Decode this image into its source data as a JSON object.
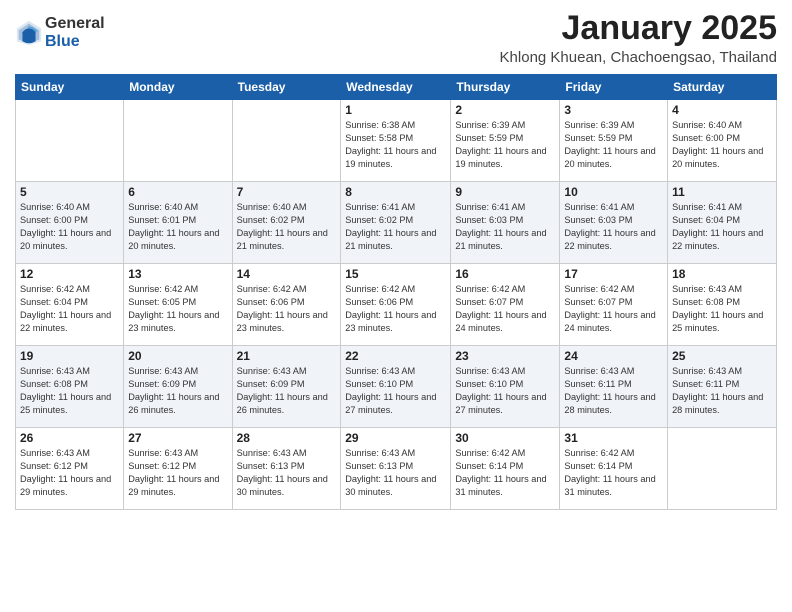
{
  "header": {
    "logo_general": "General",
    "logo_blue": "Blue",
    "month": "January 2025",
    "location": "Khlong Khuean, Chachoengsao, Thailand"
  },
  "days_of_week": [
    "Sunday",
    "Monday",
    "Tuesday",
    "Wednesday",
    "Thursday",
    "Friday",
    "Saturday"
  ],
  "weeks": [
    [
      {
        "day": "",
        "sunrise": "",
        "sunset": "",
        "daylight": ""
      },
      {
        "day": "",
        "sunrise": "",
        "sunset": "",
        "daylight": ""
      },
      {
        "day": "",
        "sunrise": "",
        "sunset": "",
        "daylight": ""
      },
      {
        "day": "1",
        "sunrise": "Sunrise: 6:38 AM",
        "sunset": "Sunset: 5:58 PM",
        "daylight": "Daylight: 11 hours and 19 minutes."
      },
      {
        "day": "2",
        "sunrise": "Sunrise: 6:39 AM",
        "sunset": "Sunset: 5:59 PM",
        "daylight": "Daylight: 11 hours and 19 minutes."
      },
      {
        "day": "3",
        "sunrise": "Sunrise: 6:39 AM",
        "sunset": "Sunset: 5:59 PM",
        "daylight": "Daylight: 11 hours and 20 minutes."
      },
      {
        "day": "4",
        "sunrise": "Sunrise: 6:40 AM",
        "sunset": "Sunset: 6:00 PM",
        "daylight": "Daylight: 11 hours and 20 minutes."
      }
    ],
    [
      {
        "day": "5",
        "sunrise": "Sunrise: 6:40 AM",
        "sunset": "Sunset: 6:00 PM",
        "daylight": "Daylight: 11 hours and 20 minutes."
      },
      {
        "day": "6",
        "sunrise": "Sunrise: 6:40 AM",
        "sunset": "Sunset: 6:01 PM",
        "daylight": "Daylight: 11 hours and 20 minutes."
      },
      {
        "day": "7",
        "sunrise": "Sunrise: 6:40 AM",
        "sunset": "Sunset: 6:02 PM",
        "daylight": "Daylight: 11 hours and 21 minutes."
      },
      {
        "day": "8",
        "sunrise": "Sunrise: 6:41 AM",
        "sunset": "Sunset: 6:02 PM",
        "daylight": "Daylight: 11 hours and 21 minutes."
      },
      {
        "day": "9",
        "sunrise": "Sunrise: 6:41 AM",
        "sunset": "Sunset: 6:03 PM",
        "daylight": "Daylight: 11 hours and 21 minutes."
      },
      {
        "day": "10",
        "sunrise": "Sunrise: 6:41 AM",
        "sunset": "Sunset: 6:03 PM",
        "daylight": "Daylight: 11 hours and 22 minutes."
      },
      {
        "day": "11",
        "sunrise": "Sunrise: 6:41 AM",
        "sunset": "Sunset: 6:04 PM",
        "daylight": "Daylight: 11 hours and 22 minutes."
      }
    ],
    [
      {
        "day": "12",
        "sunrise": "Sunrise: 6:42 AM",
        "sunset": "Sunset: 6:04 PM",
        "daylight": "Daylight: 11 hours and 22 minutes."
      },
      {
        "day": "13",
        "sunrise": "Sunrise: 6:42 AM",
        "sunset": "Sunset: 6:05 PM",
        "daylight": "Daylight: 11 hours and 23 minutes."
      },
      {
        "day": "14",
        "sunrise": "Sunrise: 6:42 AM",
        "sunset": "Sunset: 6:06 PM",
        "daylight": "Daylight: 11 hours and 23 minutes."
      },
      {
        "day": "15",
        "sunrise": "Sunrise: 6:42 AM",
        "sunset": "Sunset: 6:06 PM",
        "daylight": "Daylight: 11 hours and 23 minutes."
      },
      {
        "day": "16",
        "sunrise": "Sunrise: 6:42 AM",
        "sunset": "Sunset: 6:07 PM",
        "daylight": "Daylight: 11 hours and 24 minutes."
      },
      {
        "day": "17",
        "sunrise": "Sunrise: 6:42 AM",
        "sunset": "Sunset: 6:07 PM",
        "daylight": "Daylight: 11 hours and 24 minutes."
      },
      {
        "day": "18",
        "sunrise": "Sunrise: 6:43 AM",
        "sunset": "Sunset: 6:08 PM",
        "daylight": "Daylight: 11 hours and 25 minutes."
      }
    ],
    [
      {
        "day": "19",
        "sunrise": "Sunrise: 6:43 AM",
        "sunset": "Sunset: 6:08 PM",
        "daylight": "Daylight: 11 hours and 25 minutes."
      },
      {
        "day": "20",
        "sunrise": "Sunrise: 6:43 AM",
        "sunset": "Sunset: 6:09 PM",
        "daylight": "Daylight: 11 hours and 26 minutes."
      },
      {
        "day": "21",
        "sunrise": "Sunrise: 6:43 AM",
        "sunset": "Sunset: 6:09 PM",
        "daylight": "Daylight: 11 hours and 26 minutes."
      },
      {
        "day": "22",
        "sunrise": "Sunrise: 6:43 AM",
        "sunset": "Sunset: 6:10 PM",
        "daylight": "Daylight: 11 hours and 27 minutes."
      },
      {
        "day": "23",
        "sunrise": "Sunrise: 6:43 AM",
        "sunset": "Sunset: 6:10 PM",
        "daylight": "Daylight: 11 hours and 27 minutes."
      },
      {
        "day": "24",
        "sunrise": "Sunrise: 6:43 AM",
        "sunset": "Sunset: 6:11 PM",
        "daylight": "Daylight: 11 hours and 28 minutes."
      },
      {
        "day": "25",
        "sunrise": "Sunrise: 6:43 AM",
        "sunset": "Sunset: 6:11 PM",
        "daylight": "Daylight: 11 hours and 28 minutes."
      }
    ],
    [
      {
        "day": "26",
        "sunrise": "Sunrise: 6:43 AM",
        "sunset": "Sunset: 6:12 PM",
        "daylight": "Daylight: 11 hours and 29 minutes."
      },
      {
        "day": "27",
        "sunrise": "Sunrise: 6:43 AM",
        "sunset": "Sunset: 6:12 PM",
        "daylight": "Daylight: 11 hours and 29 minutes."
      },
      {
        "day": "28",
        "sunrise": "Sunrise: 6:43 AM",
        "sunset": "Sunset: 6:13 PM",
        "daylight": "Daylight: 11 hours and 30 minutes."
      },
      {
        "day": "29",
        "sunrise": "Sunrise: 6:43 AM",
        "sunset": "Sunset: 6:13 PM",
        "daylight": "Daylight: 11 hours and 30 minutes."
      },
      {
        "day": "30",
        "sunrise": "Sunrise: 6:42 AM",
        "sunset": "Sunset: 6:14 PM",
        "daylight": "Daylight: 11 hours and 31 minutes."
      },
      {
        "day": "31",
        "sunrise": "Sunrise: 6:42 AM",
        "sunset": "Sunset: 6:14 PM",
        "daylight": "Daylight: 11 hours and 31 minutes."
      },
      {
        "day": "",
        "sunrise": "",
        "sunset": "",
        "daylight": ""
      }
    ]
  ]
}
